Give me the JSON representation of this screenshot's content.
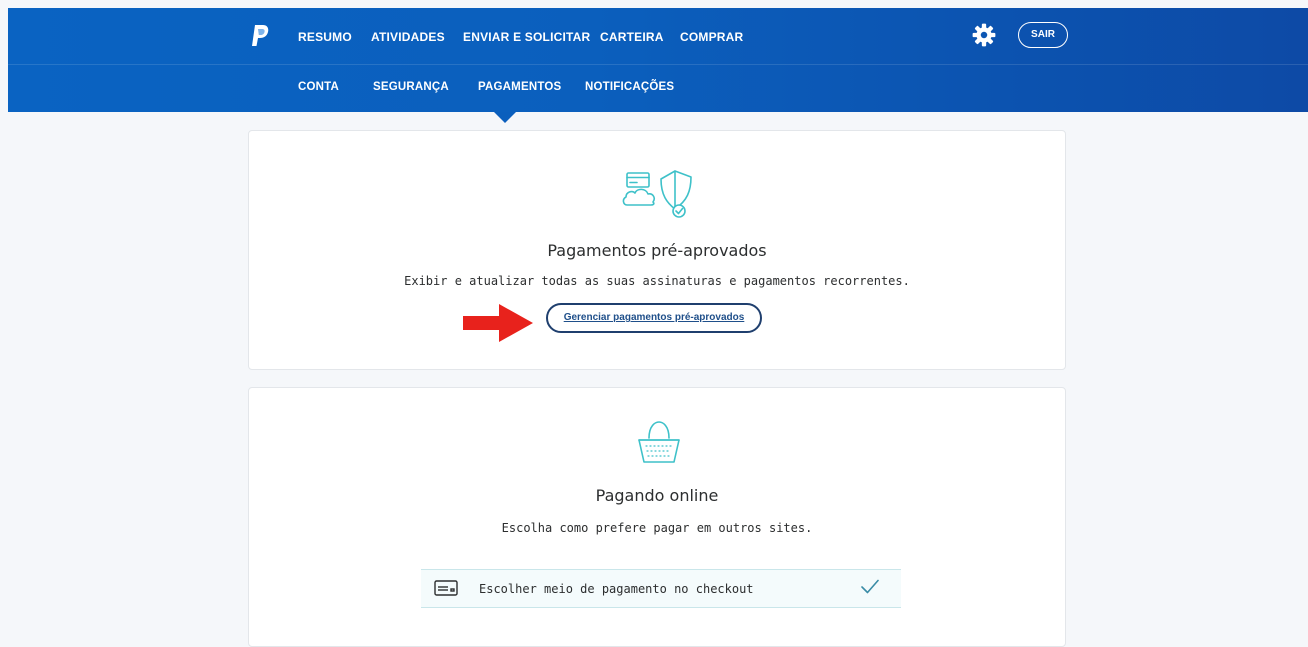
{
  "header": {
    "main_nav": [
      "RESUMO",
      "ATIVIDADES",
      "ENVIAR E SOLICITAR",
      "CARTEIRA",
      "COMPRAR"
    ],
    "sub_nav": [
      "CONTA",
      "SEGURANÇA",
      "PAGAMENTOS",
      "NOTIFICAÇÕES"
    ],
    "active_sub_nav": "PAGAMENTOS",
    "logout_label": "SAIR",
    "settings_icon": "gear-icon",
    "logo_icon": "paypal-logo-icon"
  },
  "preapproved": {
    "icon": "card-shield-cloud-icon",
    "title": "Pagamentos pré-aprovados",
    "description": "Exibir e atualizar todas as suas assinaturas e pagamentos recorrentes.",
    "button_label": "Gerenciar pagamentos pré-aprovados",
    "annotation": "red-arrow-icon"
  },
  "online": {
    "icon": "basket-icon",
    "title": "Pagando online",
    "description": "Escolha como prefere pagar em outros sites.",
    "options": [
      {
        "label": "Escolher meio de pagamento no checkout",
        "selected": true,
        "icon": "credit-card-icon"
      }
    ]
  },
  "colors": {
    "header_start": "#0a63c2",
    "header_end": "#0d4aa6",
    "accent_teal": "#3ec1c9",
    "button_border": "#1f3f6e",
    "annotation_red": "#e8221c"
  }
}
